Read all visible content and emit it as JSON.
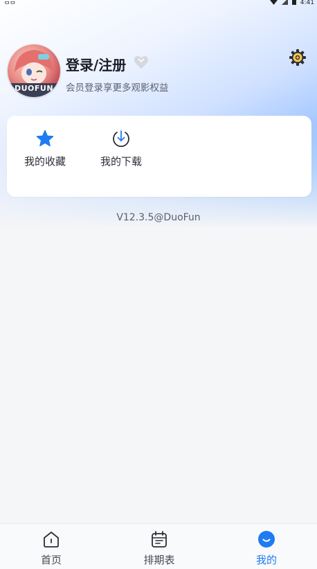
{
  "status_bar": {
    "left_text": "ᄆᄆ",
    "time": "4:41"
  },
  "profile": {
    "avatar_label": "DUOFUN",
    "login_title": "登录/注册",
    "login_subtitle": "会员登录享更多观影权益"
  },
  "shortcuts": [
    {
      "label": "我的收藏",
      "icon": "star-icon"
    },
    {
      "label": "我的下载",
      "icon": "download-icon"
    }
  ],
  "version": "V12.3.5@DuoFun",
  "tabs": [
    {
      "label": "首页",
      "icon": "home-icon",
      "active": false
    },
    {
      "label": "排期表",
      "icon": "calendar-icon",
      "active": false
    },
    {
      "label": "我的",
      "icon": "profile-icon",
      "active": true
    }
  ],
  "colors": {
    "accent": "#1f7bf2",
    "background": "#f5f6f8"
  }
}
